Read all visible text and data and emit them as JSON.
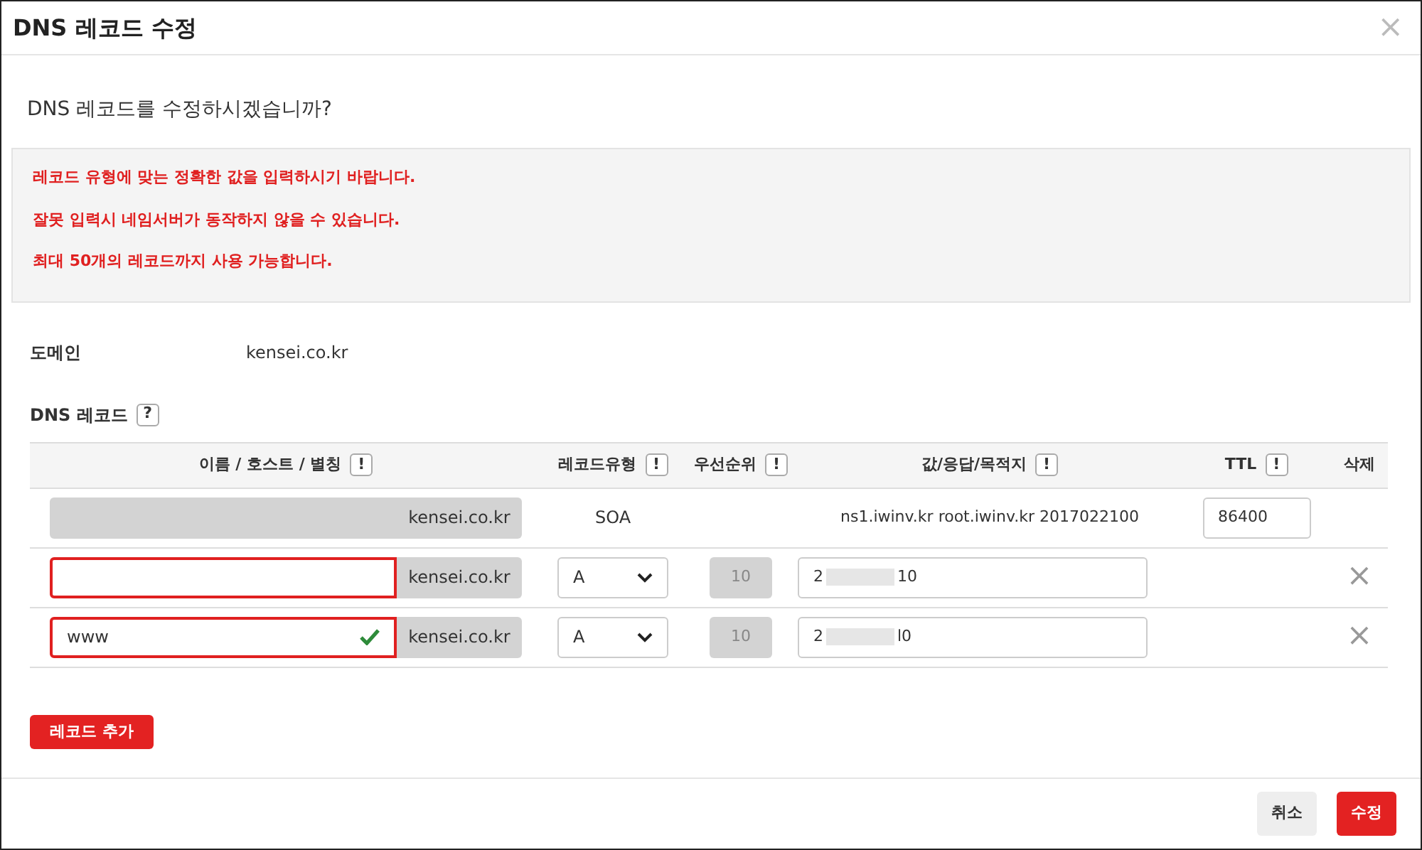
{
  "dialog": {
    "title": "DNS 레코드 수정",
    "close": "×"
  },
  "question": "DNS 레코드를 수정하시겠습니까?",
  "notices": [
    "레코드 유형에 맞는 정확한 값을 입력하시기 바랍니다.",
    "잘못 입력시 네임서버가 동작하지 않을 수 있습니다.",
    "최대 50개의 레코드까지 사용 가능합니다."
  ],
  "domain": {
    "label": "도메인",
    "value": "kensei.co.kr"
  },
  "records_section": {
    "label": "DNS 레코드",
    "help": "?"
  },
  "table": {
    "columns": [
      {
        "label": "이름 / 호스트 / 별칭",
        "hint": "!"
      },
      {
        "label": "레코드유형",
        "hint": "!"
      },
      {
        "label": "우선순위",
        "hint": "!"
      },
      {
        "label": "값/응답/목적지",
        "hint": "!"
      },
      {
        "label": "TTL",
        "hint": "!"
      },
      {
        "label": "삭제"
      }
    ],
    "rows": [
      {
        "kind": "soa",
        "suffix": "kensei.co.kr",
        "type": "SOA",
        "value": "ns1.iwinv.kr root.iwinv.kr 2017022100",
        "ttl": "86400"
      },
      {
        "kind": "record",
        "host": "",
        "error": true,
        "valid": false,
        "suffix": "kensei.co.kr",
        "type": "A",
        "priority": "10",
        "value_start": "2",
        "value_end": "10",
        "delete": "×"
      },
      {
        "kind": "record",
        "host": "www",
        "error": true,
        "valid": true,
        "suffix": "kensei.co.kr",
        "type": "A",
        "priority": "10",
        "value_start": "2",
        "value_end": "l0",
        "delete": "×"
      }
    ]
  },
  "add_button": "레코드 추가",
  "footer": {
    "cancel": "취소",
    "submit": "수정"
  }
}
